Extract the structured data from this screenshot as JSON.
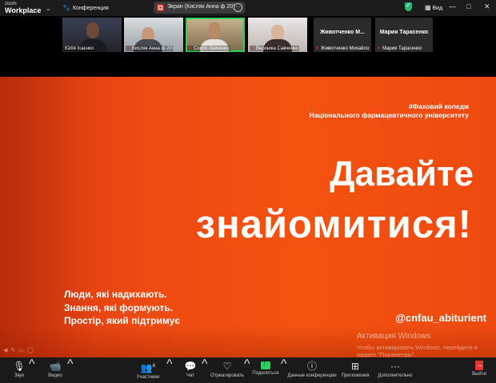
{
  "app": {
    "logo_top": "zoom",
    "logo_bottom": "Workplace"
  },
  "topbar": {
    "conference_label": "Конференция",
    "share_title": "Экран (Кисляк Анна ф 20)",
    "view_label": "Вид",
    "window_controls": [
      "—",
      "□",
      "✕"
    ]
  },
  "participants": [
    {
      "name": "Юлія Ісаєнко",
      "muted": false
    },
    {
      "name": "Кисляк Анна ф 20",
      "muted": true
    },
    {
      "name": "Софія Левченко",
      "muted": true,
      "active": true
    },
    {
      "name": "Вероніка Савченко",
      "muted": true
    },
    {
      "name": "Животченко Михайло",
      "display_name": "Животченко М...",
      "muted": true
    },
    {
      "name": "Мария Тарасенко",
      "display_name": "Мария Тарасенко",
      "muted": true
    }
  ],
  "slide": {
    "tag_line1": "#Фаховий коледж",
    "tag_line2": "Національного фармацевтичного університету",
    "heading_line1": "Давайте",
    "heading_line2": "знайомитися!",
    "slogan_line1": "Люди, які надихають.",
    "slogan_line2": "Знання, які формують.",
    "slogan_line3": "Простір, який підтримує",
    "handle": "@cnfau_abiturient",
    "watermark_title": "Активация Windows",
    "watermark_text": "Чтобы активировать Windows, перейдите в раздел \"Параметры\"."
  },
  "toolbar": {
    "audio": "Звук",
    "video": "Видео",
    "participants": "Участники",
    "participants_count": "6",
    "chat": "Чат",
    "react": "Отреагировать",
    "share": "Поделиться",
    "info": "Данные конференции",
    "apps": "Приложения",
    "more": "Дополнительно",
    "leave": "Выйти"
  },
  "colors": {
    "slide_accent": "#f4520f",
    "share_green": "#2bd15a",
    "leave_red": "#e3342f",
    "active_speaker": "#2bd15a"
  }
}
